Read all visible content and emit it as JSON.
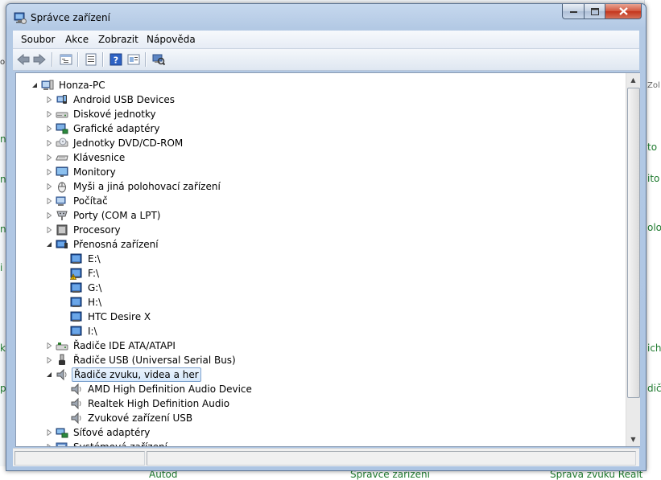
{
  "window": {
    "title": "Správce zařízení"
  },
  "background": {
    "fragments_left": [
      "ob",
      "nu",
      "nu",
      "ni",
      "i",
      "k",
      "p"
    ],
    "fragments_right": [
      "Zol",
      "to",
      "ito",
      "oloc",
      "ich",
      "dič"
    ],
    "taskbar": [
      "Autod",
      "Správce zařízení",
      "Správa zvuku Realt"
    ]
  },
  "menu": [
    "Soubor",
    "Akce",
    "Zobrazit",
    "Nápověda"
  ],
  "toolbar": [
    "back-icon",
    "forward-icon",
    "tree-view-icon",
    "properties-icon",
    "help-icon",
    "update-driver-icon",
    "scan-hardware-icon"
  ],
  "tree": {
    "root": "Honza-PC",
    "categories": [
      {
        "label": "Android USB Devices",
        "icon": "android-device-icon"
      },
      {
        "label": "Diskové jednotky",
        "icon": "disk-drive-icon"
      },
      {
        "label": "Grafické adaptéry",
        "icon": "display-adapter-icon"
      },
      {
        "label": "Jednotky DVD/CD-ROM",
        "icon": "dvd-drive-icon"
      },
      {
        "label": "Klávesnice",
        "icon": "keyboard-icon"
      },
      {
        "label": "Monitory",
        "icon": "monitor-icon"
      },
      {
        "label": "Myši a jiná polohovací zařízení",
        "icon": "mouse-icon"
      },
      {
        "label": "Počítač",
        "icon": "computer-icon"
      },
      {
        "label": "Porty (COM a LPT)",
        "icon": "port-icon"
      },
      {
        "label": "Procesory",
        "icon": "processor-icon"
      }
    ],
    "portable": {
      "label": "Přenosná zařízení",
      "children": [
        {
          "label": "E:\\",
          "warning": false
        },
        {
          "label": "F:\\",
          "warning": true
        },
        {
          "label": "G:\\",
          "warning": false
        },
        {
          "label": "H:\\",
          "warning": false
        },
        {
          "label": "HTC Desire X",
          "warning": false
        },
        {
          "label": "I:\\",
          "warning": false
        }
      ]
    },
    "categories2": [
      {
        "label": "Řadiče IDE ATA/ATAPI",
        "icon": "ide-controller-icon"
      },
      {
        "label": "Řadiče USB (Universal Serial Bus)",
        "icon": "usb-icon"
      }
    ],
    "sound": {
      "label": "Řadiče zvuku, videa a her",
      "children": [
        "AMD High Definition Audio Device",
        "Realtek High Definition Audio",
        "Zvukové zařízení USB"
      ]
    },
    "categories3": [
      {
        "label": "Síťové adaptéry",
        "icon": "network-adapter-icon"
      },
      {
        "label": "Systémová zařízení",
        "icon": "system-device-icon"
      }
    ]
  }
}
